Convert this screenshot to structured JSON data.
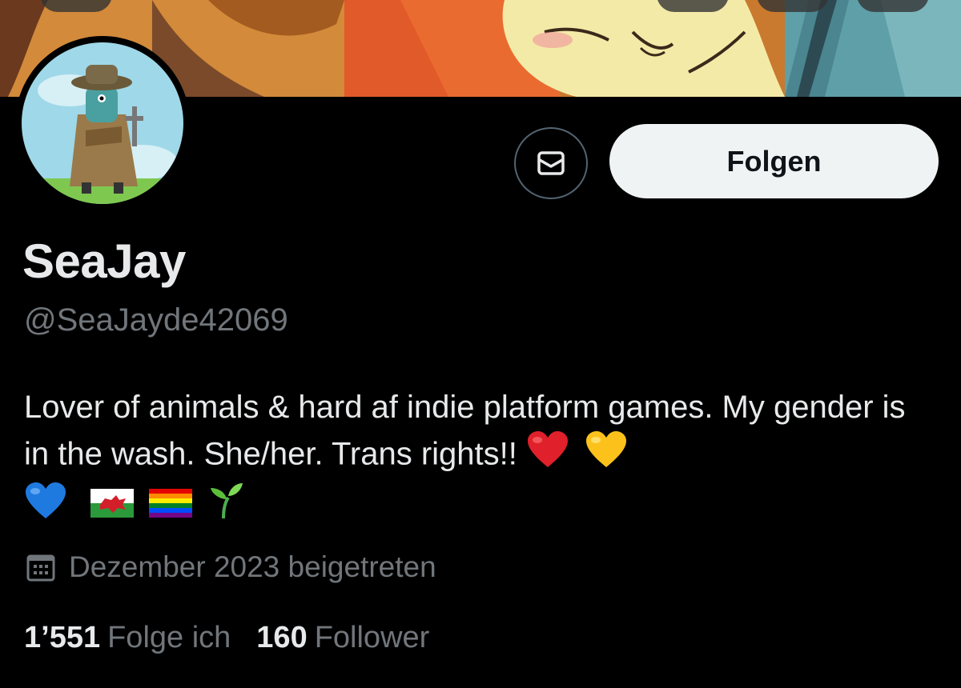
{
  "profile": {
    "display_name": "SeaJay",
    "handle": "@SeaJayde42069",
    "bio_text": "Lover of animals & hard af indie platform games. My gender is in the wash. She/her. Trans rights!!",
    "bio_emojis": [
      "red-heart",
      "yellow-heart",
      "blue-heart",
      "wales-flag",
      "rainbow-flag",
      "seedling"
    ],
    "joined": "Dezember 2023 beigetreten"
  },
  "actions": {
    "message_icon": "envelope-icon",
    "follow_label": "Folgen"
  },
  "stats": {
    "following_count": "1’551",
    "following_label": "Folge ich",
    "followers_count": "160",
    "followers_label": "Follower"
  },
  "colors": {
    "background": "#000000",
    "text_primary": "#e7e9ea",
    "text_secondary": "#71767b",
    "button_bg": "#eff3f4"
  }
}
